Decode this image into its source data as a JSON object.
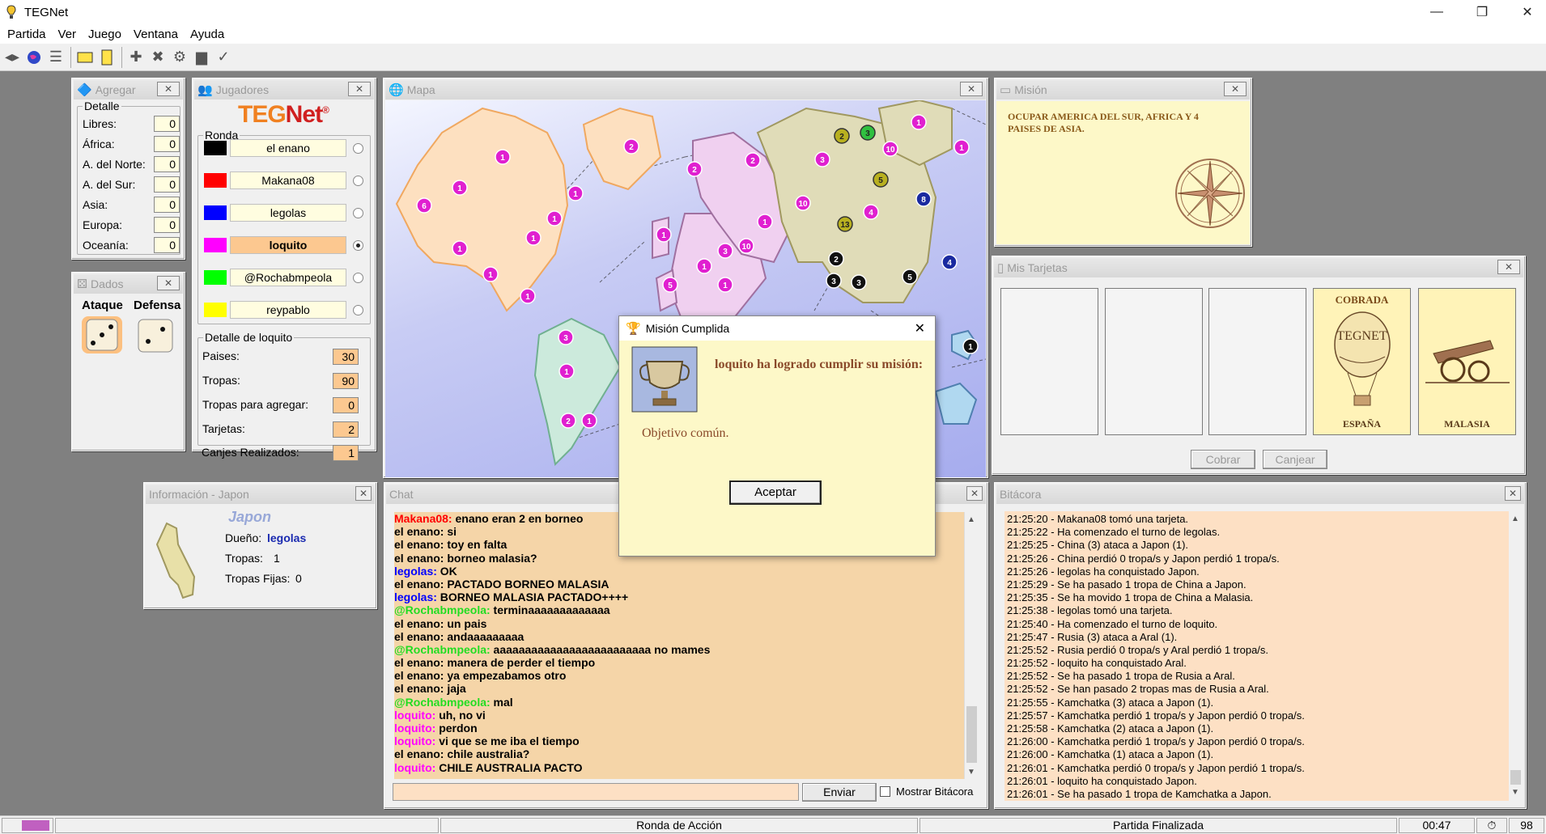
{
  "window": {
    "title": "TEGNet",
    "minimize": "—",
    "maximize": "❐",
    "close": "✕"
  },
  "menu": [
    "Partida",
    "Ver",
    "Juego",
    "Ventana",
    "Ayuda"
  ],
  "agregar": {
    "title": "Agregar",
    "group": "Detalle",
    "rows": [
      {
        "label": "Libres:",
        "value": "0"
      },
      {
        "label": "África:",
        "value": "0"
      },
      {
        "label": "A. del Norte:",
        "value": "0"
      },
      {
        "label": "A. del Sur:",
        "value": "0"
      },
      {
        "label": "Asia:",
        "value": "0"
      },
      {
        "label": "Europa:",
        "value": "0"
      },
      {
        "label": "Oceanía:",
        "value": "0"
      }
    ]
  },
  "dados": {
    "title": "Dados",
    "attack": "Ataque",
    "defense": "Defensa",
    "attack_die": 3,
    "defense_die": 2
  },
  "jugadores": {
    "title": "Jugadores",
    "logo_a": "TEG",
    "logo_b": "Net",
    "logo_mark": "®",
    "group": "Ronda",
    "players": [
      {
        "name": "el enano",
        "color": "#000000",
        "active": false
      },
      {
        "name": "Makana08",
        "color": "#ff0000",
        "active": false
      },
      {
        "name": "legolas",
        "color": "#0000ff",
        "active": false
      },
      {
        "name": "loquito",
        "color": "#ff00ff",
        "active": true
      },
      {
        "name": "@Rochabmpeola",
        "color": "#00ff00",
        "active": false
      },
      {
        "name": "reypablo",
        "color": "#ffff00",
        "active": false
      }
    ],
    "detail_group": "Detalle de loquito",
    "detail": [
      {
        "label": "Paises:",
        "value": "30"
      },
      {
        "label": "Tropas:",
        "value": "90"
      },
      {
        "label": "Tropas para agregar:",
        "value": "0"
      },
      {
        "label": "Tarjetas:",
        "value": "2"
      },
      {
        "label": "Canjes Realizados:",
        "value": "1"
      }
    ]
  },
  "mapa": {
    "title": "Mapa"
  },
  "mision": {
    "title": "Misión",
    "text": "OCUPAR AMERICA DEL SUR, AFRICA Y 4 PAISES DE ASIA."
  },
  "tarjetas": {
    "title": "Mis Tarjetas",
    "cards": [
      {
        "top": "",
        "bottom": "",
        "empty": true
      },
      {
        "top": "",
        "bottom": "",
        "empty": true
      },
      {
        "top": "",
        "bottom": "",
        "empty": true
      },
      {
        "top": "COBRADA",
        "bottom": "ESPAÑA",
        "empty": false,
        "art": "TEGNET"
      },
      {
        "top": "",
        "bottom": "MALASIA",
        "empty": false,
        "art": ""
      }
    ],
    "cobrar": "Cobrar",
    "canjear": "Canjear"
  },
  "info": {
    "title": "Información - Japon",
    "country": "Japon",
    "owner_label": "Dueño:",
    "owner": "legolas",
    "troops_label": "Tropas:",
    "troops": "1",
    "fixed_label": "Tropas Fijas:",
    "fixed": "0"
  },
  "chat": {
    "title": "Chat",
    "send": "Enviar",
    "show_log": "Mostrar Bitácora",
    "input": "",
    "lines": [
      {
        "who": "Makana08:",
        "color": "#ff0000",
        "msg": " enano eran 2 en borneo"
      },
      {
        "who": "el enano:",
        "color": "#000000",
        "msg": " si"
      },
      {
        "who": "el enano:",
        "color": "#000000",
        "msg": " toy en falta"
      },
      {
        "who": "el enano:",
        "color": "#000000",
        "msg": " borneo malasia?"
      },
      {
        "who": "legolas:",
        "color": "#0000ff",
        "msg": " OK"
      },
      {
        "who": "el enano:",
        "color": "#000000",
        "msg": " PACTADO BORNEO MALASIA"
      },
      {
        "who": "legolas:",
        "color": "#0000ff",
        "msg": " BORNEO MALASIA PACTADO++++"
      },
      {
        "who": "@Rochabmpeola:",
        "color": "#22dd22",
        "msg": " terminaaaaaaaaaaaaa"
      },
      {
        "who": "el enano:",
        "color": "#000000",
        "msg": " un pais"
      },
      {
        "who": "el enano:",
        "color": "#000000",
        "msg": " andaaaaaaaaa"
      },
      {
        "who": "@Rochabmpeola:",
        "color": "#22dd22",
        "msg": " aaaaaaaaaaaaaaaaaaaaaaaaa no mames"
      },
      {
        "who": "el enano:",
        "color": "#000000",
        "msg": " manera de perder el tiempo"
      },
      {
        "who": "el enano:",
        "color": "#000000",
        "msg": " ya empezabamos otro"
      },
      {
        "who": "el enano:",
        "color": "#000000",
        "msg": " jaja"
      },
      {
        "who": "@Rochabmpeola:",
        "color": "#22dd22",
        "msg": " mal"
      },
      {
        "who": "loquito:",
        "color": "#ff00ff",
        "msg": " uh, no vi"
      },
      {
        "who": "loquito:",
        "color": "#ff00ff",
        "msg": " perdon"
      },
      {
        "who": "loquito:",
        "color": "#ff00ff",
        "msg": " vi que se me iba el tiempo"
      },
      {
        "who": "el enano:",
        "color": "#000000",
        "msg": " chile australia?"
      },
      {
        "who": "loquito:",
        "color": "#ff00ff",
        "msg": " CHILE AUSTRALIA PACTO"
      }
    ]
  },
  "bitacora": {
    "title": "Bitácora",
    "lines": [
      "21:25:20 - Makana08 tomó una tarjeta.",
      "21:25:22 - Ha comenzado el turno de legolas.",
      "21:25:25 - China (3) ataca a Japon (1).",
      "21:25:26 - China perdió 0 tropa/s y Japon perdió 1 tropa/s.",
      "21:25:26 - legolas ha conquistado Japon.",
      "21:25:29 - Se ha pasado 1 tropa de China a Japon.",
      "21:25:35 - Se ha movido 1 tropa de China a Malasia.",
      "21:25:38 - legolas tomó una tarjeta.",
      "21:25:40 - Ha comenzado el turno de loquito.",
      "21:25:47 - Rusia (3) ataca a Aral (1).",
      "21:25:52 - Rusia perdió 0 tropa/s y Aral perdió 1 tropa/s.",
      "21:25:52 - loquito ha conquistado Aral.",
      "21:25:52 - Se ha pasado 1 tropa de Rusia a Aral.",
      "21:25:52 - Se han pasado 2 tropas mas de Rusia a Aral.",
      "21:25:55 - Kamchatka (3) ataca a Japon (1).",
      "21:25:57 - Kamchatka perdió 1 tropa/s y Japon perdió 0 tropa/s.",
      "21:25:58 - Kamchatka (2) ataca a Japon (1).",
      "21:26:00 - Kamchatka perdió 1 tropa/s y Japon perdió 0 tropa/s.",
      "21:26:00 - Kamchatka (1) ataca a Japon (1).",
      "21:26:01 - Kamchatka perdió 0 tropa/s y Japon perdió 1 tropa/s.",
      "21:26:01 - loquito ha conquistado Japon.",
      "21:26:01 - Se ha pasado 1 tropa de Kamchatka a Japon."
    ]
  },
  "dialog": {
    "title": "Misión Cumplida",
    "heading": "loquito ha logrado cumplir su misión:",
    "body": "Objetivo común.",
    "ok": "Aceptar"
  },
  "status": {
    "phase": "Ronda de Acción",
    "game": "Partida Finalizada",
    "time": "00:47",
    "count": "98"
  },
  "colors": {
    "chat_bg": "#f5d5a8",
    "log_bg": "#fde0c4",
    "mission_bg": "#fdf8c8",
    "card_bg": "#fff3b8"
  }
}
